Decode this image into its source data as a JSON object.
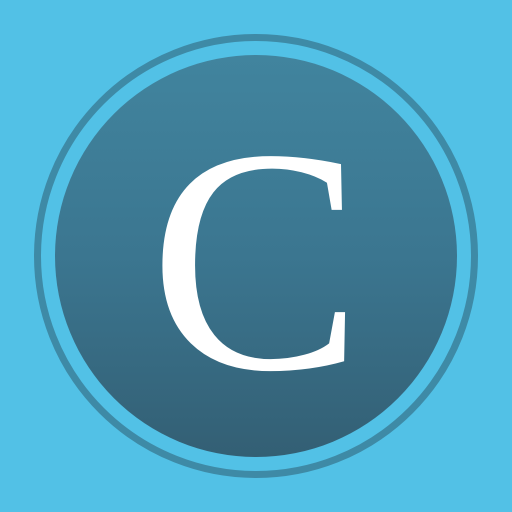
{
  "icon": {
    "letter": "C",
    "colors": {
      "background": "#52c1e6",
      "ring": "#3e8aa6",
      "disc_top": "#41849e",
      "disc_bottom": "#335f74",
      "letter": "#ffffff"
    }
  }
}
